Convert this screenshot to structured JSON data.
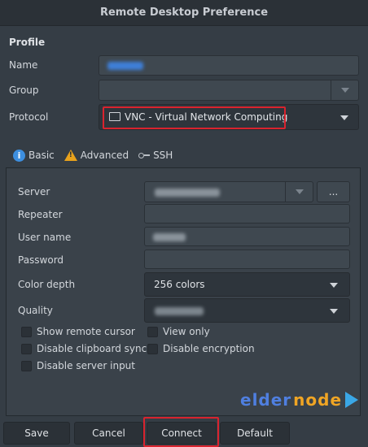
{
  "window": {
    "title": "Remote Desktop Preference"
  },
  "profile": {
    "section_label": "Profile",
    "name_label": "Name",
    "group_label": "Group",
    "protocol_label": "Protocol",
    "protocol_value": "VNC - Virtual Network Computing"
  },
  "tabs": [
    {
      "label": "Basic",
      "icon": "info-icon",
      "active": true
    },
    {
      "label": "Advanced",
      "icon": "warning-icon",
      "active": false
    },
    {
      "label": "SSH",
      "icon": "key-icon",
      "active": false
    }
  ],
  "basic": {
    "server_label": "Server",
    "browse_label": "...",
    "repeater_label": "Repeater",
    "username_label": "User name",
    "password_label": "Password",
    "color_depth_label": "Color depth",
    "color_depth_value": "256 colors",
    "quality_label": "Quality",
    "checkboxes": {
      "show_remote_cursor": "Show remote cursor",
      "view_only": "View only",
      "disable_clipboard_sync": "Disable clipboard sync",
      "disable_encryption": "Disable encryption",
      "disable_server_input": "Disable server input"
    }
  },
  "buttons": {
    "save": "Save",
    "cancel": "Cancel",
    "connect": "Connect",
    "default": "Default"
  },
  "watermark": {
    "part1": "elder",
    "part2": "node"
  },
  "colors": {
    "highlight": "#d9232e",
    "accent": "#3d8fe0",
    "warning": "#e8a21c"
  }
}
